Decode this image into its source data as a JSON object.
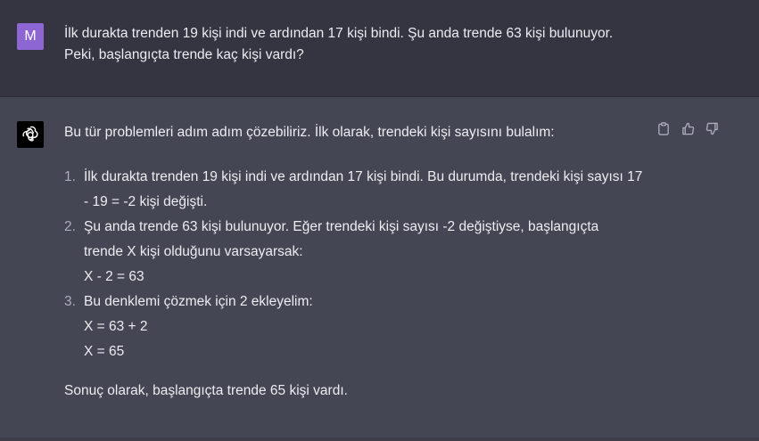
{
  "user_message": {
    "avatar_letter": "M",
    "lines": [
      "İlk durakta trenden 19 kişi indi ve ardından 17 kişi bindi. Şu anda trende 63 kişi bulunuyor.",
      "Peki, başlangıçta trende kaç kişi vardı?"
    ]
  },
  "assistant_message": {
    "intro": "Bu tür problemleri adım adım çözebiliriz. İlk olarak, trendeki kişi sayısını bulalım:",
    "steps": [
      {
        "number": "1.",
        "lines": [
          "İlk durakta trenden 19 kişi indi ve ardından 17 kişi bindi. Bu durumda, trendeki kişi sayısı 17",
          "- 19 = -2 kişi değişti."
        ]
      },
      {
        "number": "2.",
        "lines": [
          "Şu anda trende 63 kişi bulunuyor. Eğer trendeki kişi sayısı -2 değiştiyse, başlangıçta",
          "trende X kişi olduğunu varsayarsak:",
          "X - 2 = 63"
        ]
      },
      {
        "number": "3.",
        "lines": [
          "Bu denklemi çözmek için 2 ekleyelim:",
          "X = 63 + 2",
          "X = 65"
        ]
      }
    ],
    "conclusion": "Sonuç olarak, başlangıçta trende 65 kişi vardı."
  },
  "actions": {
    "icons": [
      "clipboard-icon",
      "thumbs-up-icon",
      "thumbs-down-icon"
    ]
  },
  "colors": {
    "user_bg": "#343541",
    "assistant_bg": "#444654",
    "user_avatar": "#8e66d3",
    "text": "#ececf1",
    "muted": "#acacbe"
  }
}
